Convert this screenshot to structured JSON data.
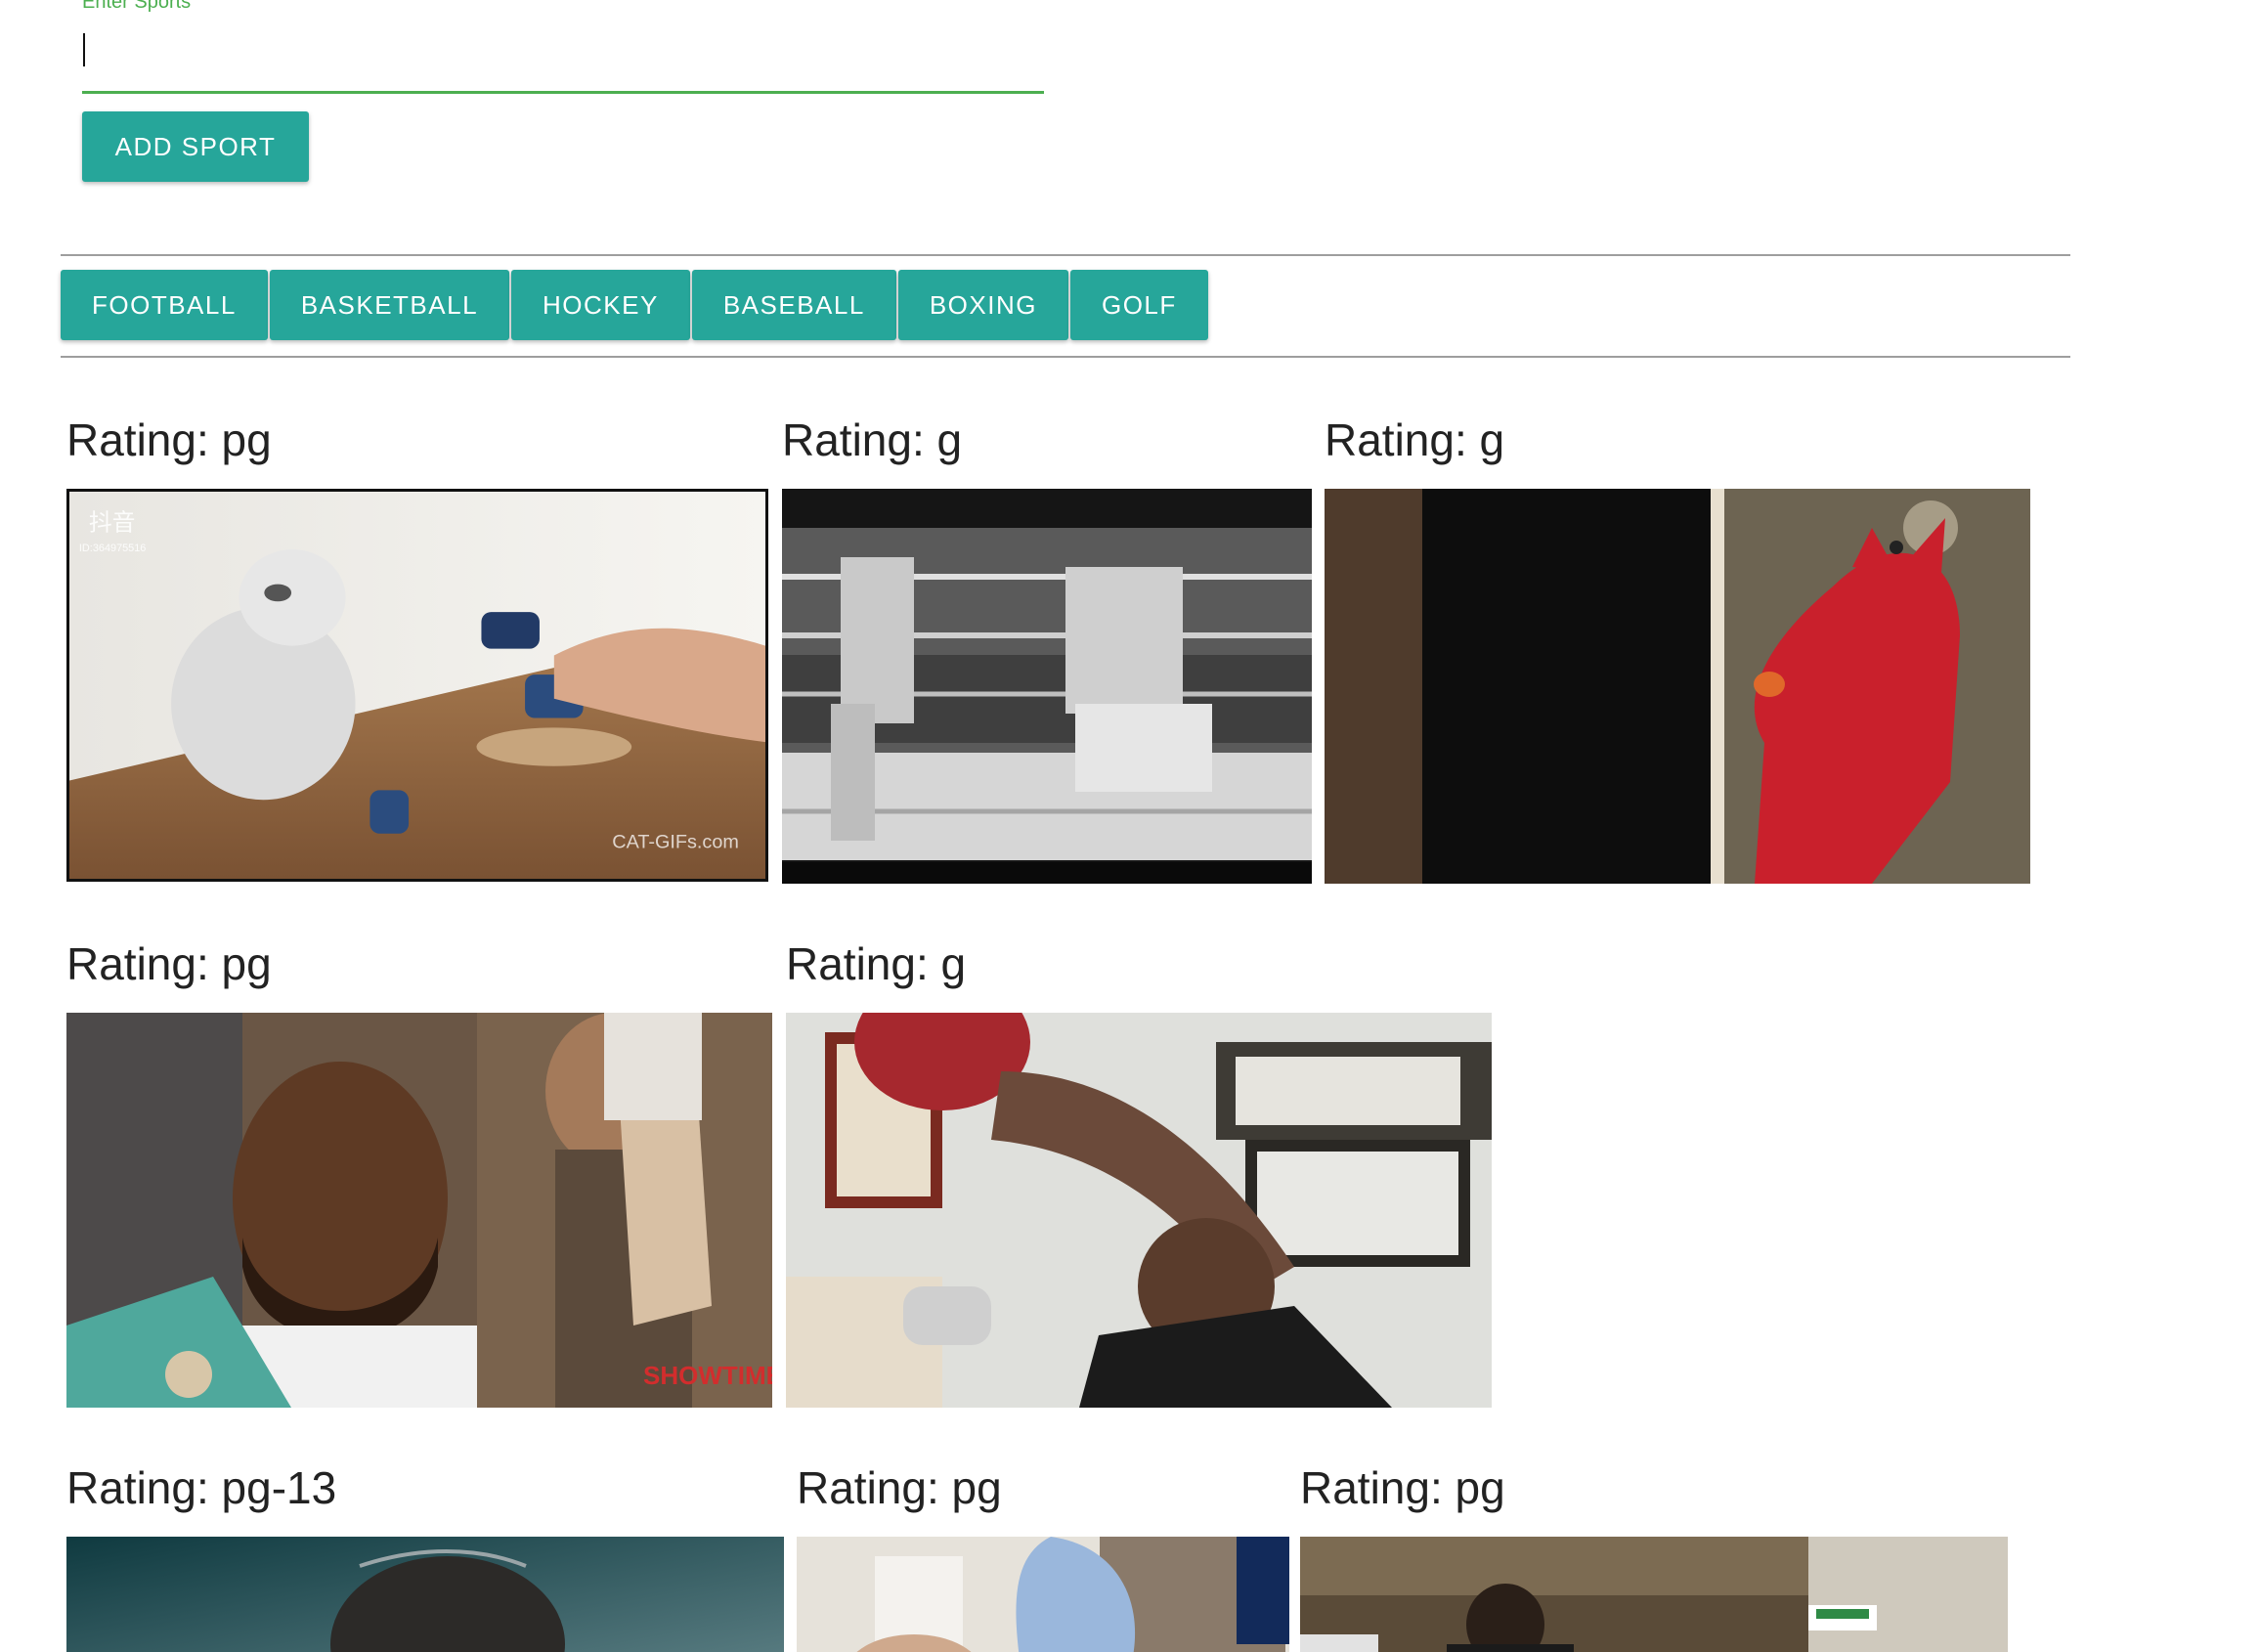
{
  "form": {
    "label": "Enter Sports",
    "input_value": "",
    "add_button": "ADD SPORT"
  },
  "sports": [
    "FOOTBALL",
    "BASKETBALL",
    "HOCKEY",
    "BASEBALL",
    "BOXING",
    "GOLF"
  ],
  "gifs": [
    {
      "rating": "Rating: pg",
      "subject": "cat-boxing-gloves",
      "watermark": "CAT-GIFs.com",
      "corner_tag": "抖音",
      "corner_id": "ID:364975516"
    },
    {
      "rating": "Rating: g",
      "subject": "vintage-boxing-match"
    },
    {
      "rating": "Rating: g",
      "subject": "red-puppet-punching-bag"
    },
    {
      "rating": "Rating: pg",
      "subject": "boxer-hand-raised",
      "watermark": "SHOWTIME"
    },
    {
      "rating": "Rating: g",
      "subject": "boxer-training-speed-bag"
    },
    {
      "rating": "Rating: pg-13",
      "subject": "boxer-dark-portrait"
    },
    {
      "rating": "Rating: pg",
      "subject": "boxer-glove-motion"
    },
    {
      "rating": "Rating: pg",
      "subject": "boxer-outdoor-walk"
    }
  ]
}
